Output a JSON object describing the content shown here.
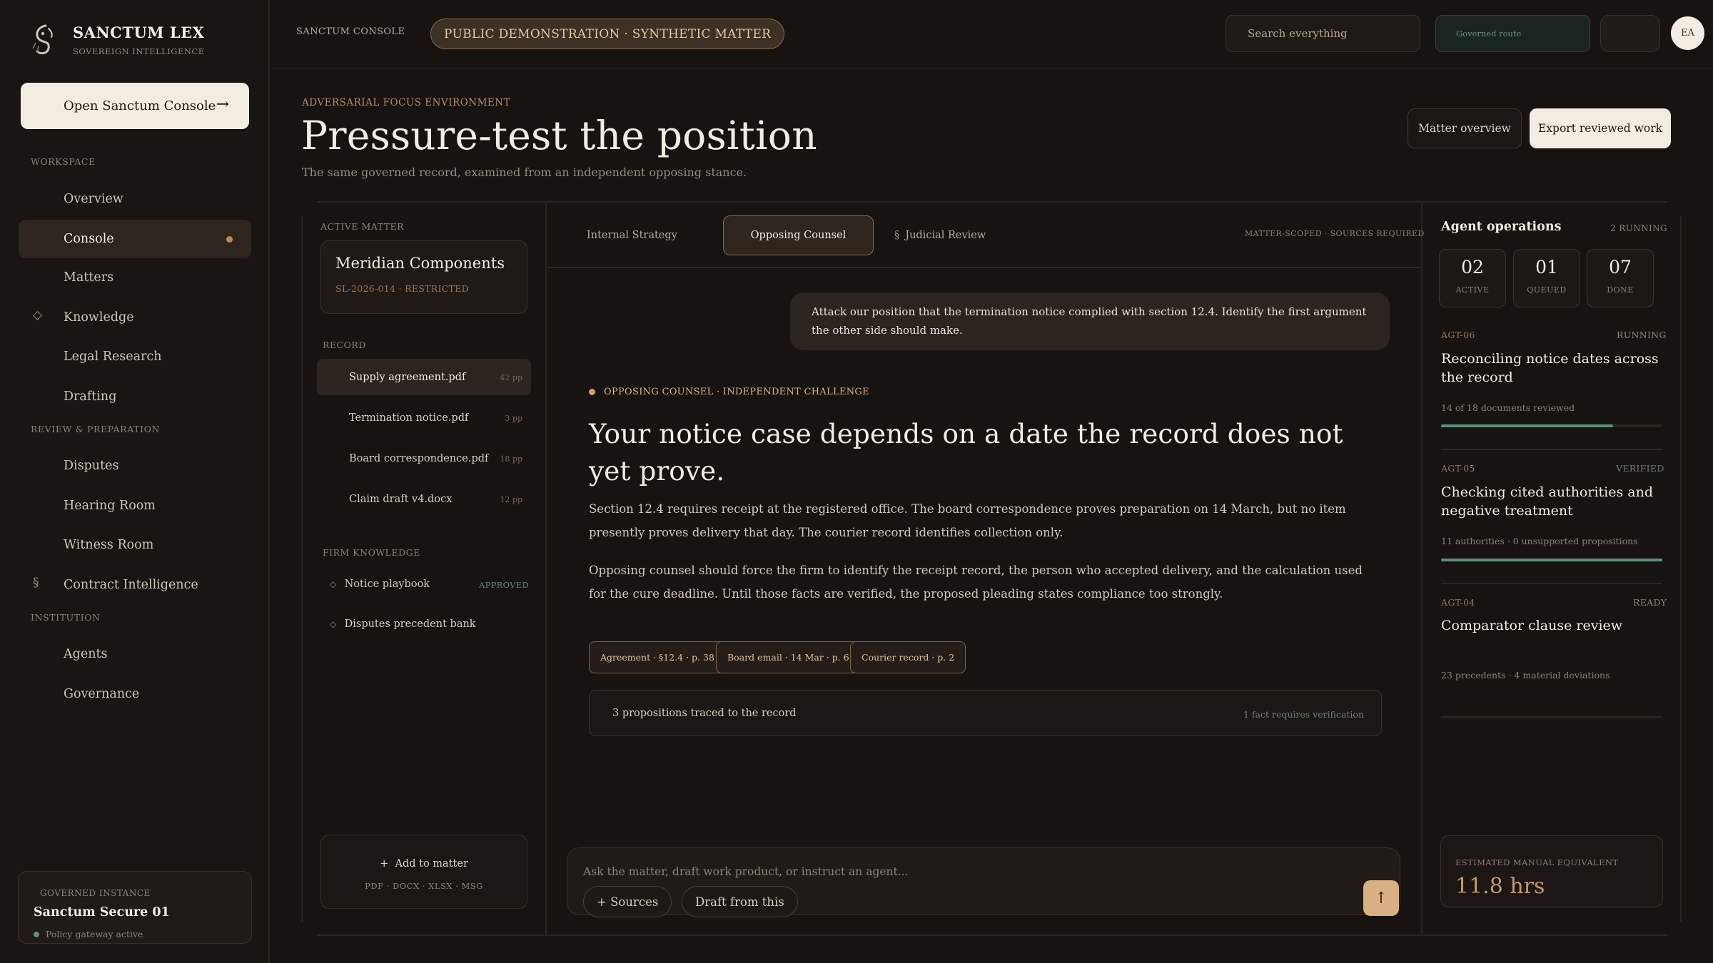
{
  "brand": {
    "name": "SANCTUM LEX",
    "tagline": "SOVEREIGN INTELLIGENCE",
    "logo_icon": "crest-icon"
  },
  "sidebar": {
    "open_console": {
      "label": "Open Sanctum Console",
      "icon": "arrow-right-icon"
    },
    "sections": [
      {
        "label": "WORKSPACE"
      },
      {
        "label": "REVIEW & PREPARATION"
      },
      {
        "label": "INSTITUTION"
      }
    ],
    "items": [
      {
        "label": "Overview"
      },
      {
        "label": "Console",
        "active": true
      },
      {
        "label": "Matters"
      },
      {
        "label": "Knowledge",
        "icon": "diamond-icon"
      },
      {
        "label": "Legal Research"
      },
      {
        "label": "Drafting"
      },
      {
        "label": "Disputes"
      },
      {
        "label": "Hearing Room"
      },
      {
        "label": "Witness Room"
      },
      {
        "label": "Contract Intelligence",
        "icon": "section-sign-icon"
      },
      {
        "label": "Agents"
      },
      {
        "label": "Governance"
      }
    ],
    "instance": {
      "label": "GOVERNED INSTANCE",
      "name": "Sanctum Secure 01",
      "status": "Policy gateway active",
      "status_color": "#5e8f78"
    }
  },
  "topbar": {
    "crumb": "SANCTUM CONSOLE",
    "demo_pill": "PUBLIC DEMONSTRATION · SYNTHETIC MATTER",
    "search_placeholder": "Search everything",
    "route_label": "Governed route",
    "avatar_initials": "EA"
  },
  "header": {
    "eyebrow": "ADVERSARIAL FOCUS ENVIRONMENT",
    "title": "Pressure-test the position",
    "subtitle": "The same governed record, examined from an independent opposing stance.",
    "matter_overview": "Matter overview",
    "export": "Export reviewed work"
  },
  "left_panel": {
    "active_matter_label": "ACTIVE MATTER",
    "matter": {
      "name": "Meridian Components",
      "meta": "SL-2026-014 · RESTRICTED"
    },
    "record_label": "RECORD",
    "records": [
      {
        "name": "Supply agreement.pdf",
        "pages": "42 pp",
        "active": true
      },
      {
        "name": "Termination notice.pdf",
        "pages": "3 pp"
      },
      {
        "name": "Board correspondence.pdf",
        "pages": "18 pp"
      },
      {
        "name": "Claim draft v4.docx",
        "pages": "12 pp"
      }
    ],
    "firm_knowledge_label": "FIRM KNOWLEDGE",
    "knowledge": [
      {
        "name": "Notice playbook",
        "badge": "APPROVED"
      },
      {
        "name": "Disputes precedent bank"
      }
    ],
    "add": {
      "label": "Add to matter",
      "formats": "PDF · DOCX · XLSX · MSG"
    }
  },
  "center": {
    "tabs": [
      {
        "label": "Internal Strategy"
      },
      {
        "label": "Opposing Counsel",
        "active": true
      },
      {
        "label": "Judicial Review",
        "icon": "section-sign-icon"
      }
    ],
    "tab_note": "MATTER-SCOPED · SOURCES REQUIRED",
    "user_message": "Attack our position that the termination notice complied with section 12.4. Identify the first argument the other side should make.",
    "response_tag": "OPPOSING COUNSEL · INDEPENDENT CHALLENGE",
    "headline": "Your notice case depends on a date the record does not yet prove.",
    "paragraphs": [
      "Section 12.4 requires receipt at the registered office. The board correspondence proves preparation on 14 March, but no item presently proves delivery that day. The courier record identifies collection only.",
      "Opposing counsel should force the firm to identify the receipt record, the person who accepted delivery, and the calculation used for the cure deadline. Until those facts are verified, the proposed pleading states compliance too strongly."
    ],
    "citations": [
      "Agreement · §12.4 · p. 38",
      "Board email · 14 Mar · p. 6",
      "Courier record · p. 2"
    ],
    "trace": {
      "left": "3 propositions traced to the record",
      "right": "1 fact requires verification"
    },
    "composer": {
      "placeholder": "Ask the matter, draft work product, or instruct an agent...",
      "sources": "+ Sources",
      "draft": "Draft from this",
      "send_icon": "arrow-up-icon"
    }
  },
  "right_panel": {
    "title": "Agent operations",
    "running": "2 RUNNING",
    "stats": [
      {
        "value": "02",
        "label": "ACTIVE"
      },
      {
        "value": "01",
        "label": "QUEUED"
      },
      {
        "value": "07",
        "label": "DONE"
      }
    ],
    "agents": [
      {
        "id": "AGT-06",
        "state": "RUNNING",
        "title": "Reconciling notice dates across the record",
        "detail": "14 of 18 documents reviewed",
        "progress": 0.778
      },
      {
        "id": "AGT-05",
        "state": "VERIFIED",
        "title": "Checking cited authorities and negative treatment",
        "detail": "11 authorities · 0 unsupported propositions",
        "progress": 1.0
      },
      {
        "id": "AGT-04",
        "state": "READY",
        "title": "Comparator clause review",
        "detail": "23 precedents · 4 material deviations"
      }
    ],
    "estimate": {
      "label": "ESTIMATED MANUAL EQUIVALENT",
      "value": "11.8 hrs"
    }
  }
}
